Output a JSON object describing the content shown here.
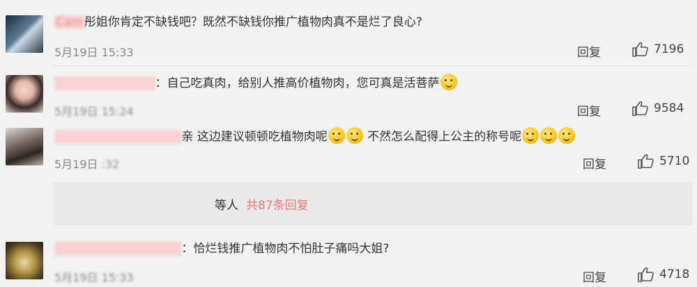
{
  "comments": [
    {
      "user": "Cam",
      "text": "彤姐你肯定不缺钱吧？既然不缺钱你推广植物肉真不是烂了良心?",
      "time": "5月19日 15:33",
      "reply_label": "回复",
      "likes": "7196",
      "avatar_icon": "avatar-image"
    },
    {
      "user": "",
      "text": "自己吃真肉，给别人推高价植物肉，您可真是活菩萨",
      "time": "5月19日 15:24",
      "reply_label": "回复",
      "likes": "9584",
      "emoji_count": 1
    },
    {
      "user": "",
      "text_part1": "亲 这边建议顿顿吃植物肉呢",
      "text_part2": " 不然怎么配得上公主的称号呢",
      "time": "5月19日 ",
      "time_blurred": ":32",
      "reply_label": "回复",
      "likes": "5710"
    },
    {
      "user": "",
      "text": "恰烂钱推广植物肉不怕肚子痛吗大姐?",
      "time": "5月19日 15:33",
      "reply_label": "回复",
      "likes": "4718"
    }
  ],
  "reply_summary": {
    "names": "",
    "etc": "等人",
    "count": "共87条回复"
  },
  "colors": {
    "background": "#f2f2f2",
    "username_pink": "#f08a8a",
    "link_pink": "#eb7a7a",
    "text": "#333333",
    "meta": "#8a8a8a"
  },
  "icons": {
    "like": "thumbs-up-icon",
    "emoji": "emoji-face-icon"
  }
}
